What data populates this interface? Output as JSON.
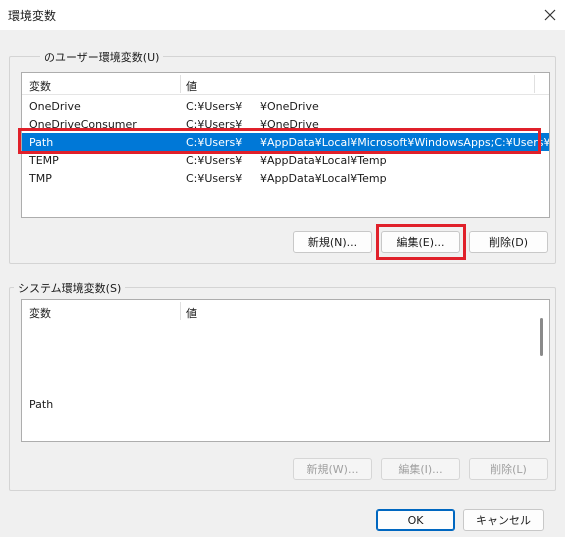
{
  "window": {
    "title": "環境変数"
  },
  "user_vars": {
    "group_label": "のユーザー環境変数(U)",
    "col_name": "変数",
    "col_value": "値",
    "rows": [
      {
        "name": "OneDrive",
        "value_a": "C:¥Users¥",
        "value_b": "¥OneDrive"
      },
      {
        "name": "OneDriveConsumer",
        "value_a": "C:¥Users¥",
        "value_b": "¥OneDrive"
      },
      {
        "name": "Path",
        "value_a": "C:¥Users¥",
        "value_b": "¥AppData¥Local¥Microsoft¥WindowsApps;C:¥Users¥..."
      },
      {
        "name": "TEMP",
        "value_a": "C:¥Users¥",
        "value_b": "¥AppData¥Local¥Temp"
      },
      {
        "name": "TMP",
        "value_a": "C:¥Users¥",
        "value_b": "¥AppData¥Local¥Temp"
      }
    ],
    "new_label": "新規(N)...",
    "edit_label": "編集(E)...",
    "delete_label": "削除(D)"
  },
  "system_vars": {
    "group_label": "システム環境変数(S)",
    "col_name": "変数",
    "col_value": "値",
    "rows": [
      {
        "name": "Path"
      }
    ],
    "new_label": "新規(W)...",
    "edit_label": "編集(I)...",
    "delete_label": "削除(L)"
  },
  "footer": {
    "ok_label": "OK",
    "cancel_label": "キャンセル"
  },
  "colors": {
    "selection": "#0078d7",
    "highlight": "#e0202a",
    "default_button_border": "#0067c0"
  }
}
